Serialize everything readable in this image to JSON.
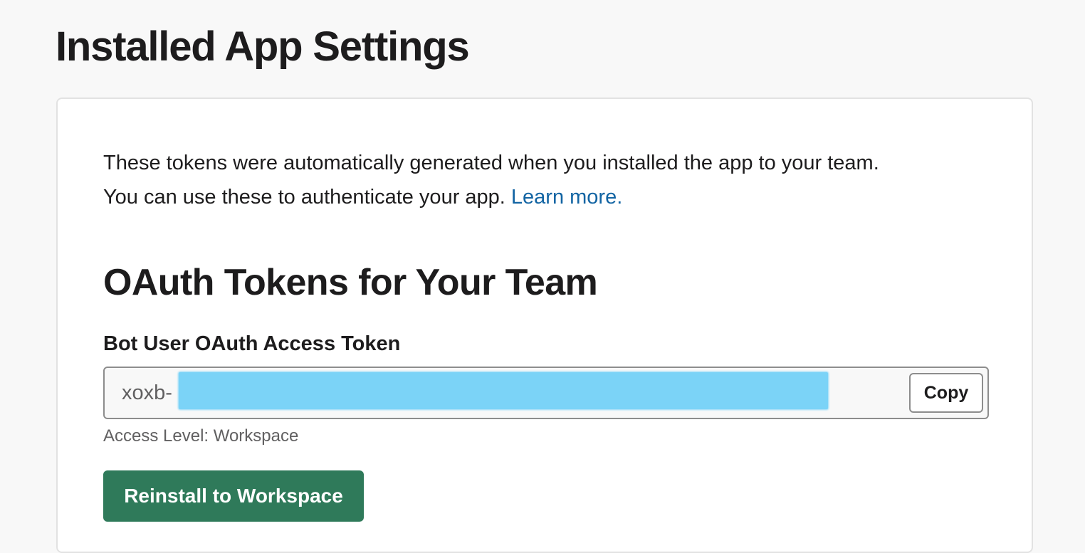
{
  "page": {
    "title": "Installed App Settings"
  },
  "intro": {
    "text_line1": "These tokens were automatically generated when you installed the app to your team.",
    "text_line2": "You can use these to authenticate your app.",
    "learn_more": "Learn more."
  },
  "oauth": {
    "section_title": "OAuth Tokens for Your Team",
    "token_label": "Bot User OAuth Access Token",
    "token_prefix": "xoxb-",
    "copy_label": "Copy",
    "access_level": "Access Level: Workspace",
    "reinstall_label": "Reinstall to Workspace"
  },
  "colors": {
    "accent_button": "#2f7a5a",
    "link": "#1264a3",
    "redaction": "#7bd3f7"
  }
}
